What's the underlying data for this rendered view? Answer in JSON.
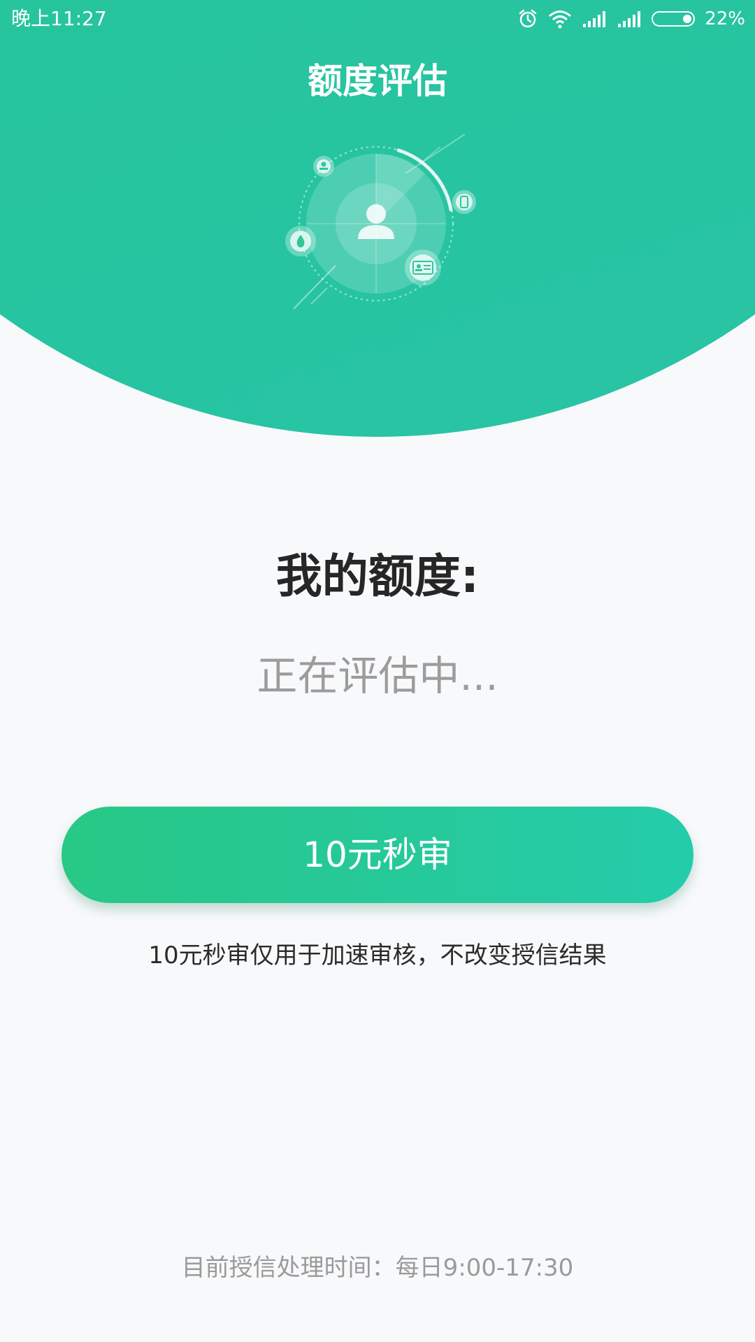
{
  "status_bar": {
    "time": "晚上11:27",
    "battery": "22%",
    "icons": [
      "alarm-icon",
      "wifi-icon",
      "signal-icon",
      "signal-icon",
      "battery-icon"
    ]
  },
  "header": {
    "title": "额度评估"
  },
  "quota": {
    "label": "我的额度:",
    "status": "正在评估中..."
  },
  "action": {
    "button_label": "10元秒审",
    "note": "10元秒审仅用于加速审核，不改变授信结果"
  },
  "footer": {
    "text": "目前授信处理时间：每日9:00-17:30"
  },
  "colors": {
    "accent_green": "#27c78b",
    "accent_teal": "#25ccaa",
    "background": "#f8f9fb"
  }
}
